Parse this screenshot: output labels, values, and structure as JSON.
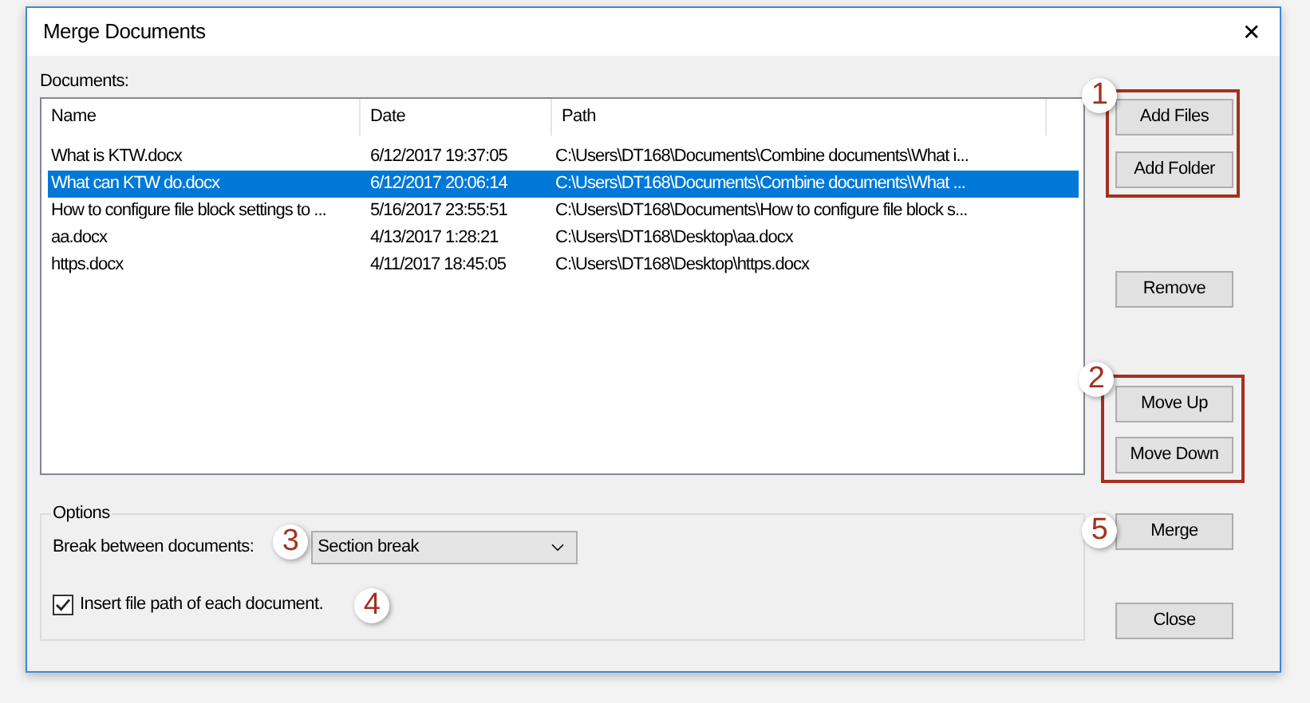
{
  "window": {
    "title": "Merge Documents",
    "close": "✕"
  },
  "documents": {
    "label": "Documents:",
    "columns": [
      "Name",
      "Date",
      "Path"
    ],
    "rows": [
      {
        "name": "What is KTW.docx",
        "date": "6/12/2017 19:37:05",
        "path": "C:\\Users\\DT168\\Documents\\Combine documents\\What i...",
        "selected": false
      },
      {
        "name": "What can KTW do.docx",
        "date": "6/12/2017 20:06:14",
        "path": "C:\\Users\\DT168\\Documents\\Combine documents\\What ...",
        "selected": true
      },
      {
        "name": "How to configure file block settings to ...",
        "date": "5/16/2017 23:55:51",
        "path": "C:\\Users\\DT168\\Documents\\How to configure file block s...",
        "selected": false
      },
      {
        "name": "aa.docx",
        "date": "4/13/2017 1:28:21",
        "path": "C:\\Users\\DT168\\Desktop\\aa.docx",
        "selected": false
      },
      {
        "name": "https.docx",
        "date": "4/11/2017 18:45:05",
        "path": "C:\\Users\\DT168\\Desktop\\https.docx",
        "selected": false
      }
    ]
  },
  "options": {
    "title": "Options",
    "break_label": "Break between documents:",
    "break_value": "Section break",
    "insert_path": {
      "label": "Insert file path of each document.",
      "checked": true
    }
  },
  "buttons": [
    "Add Files",
    "Add Folder",
    "Remove",
    "Move Up",
    "Move Down",
    "Merge",
    "Close"
  ],
  "callouts": [
    "1",
    "2",
    "3",
    "4",
    "5"
  ]
}
